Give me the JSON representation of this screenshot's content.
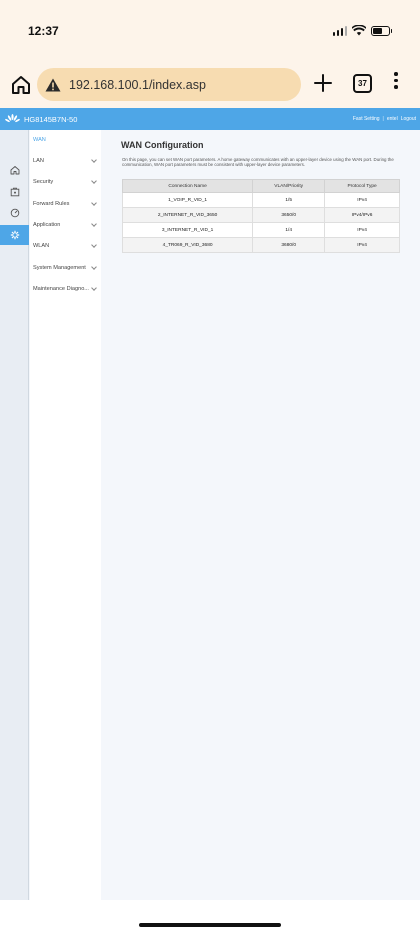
{
  "status_bar": {
    "time": "12:37"
  },
  "browser": {
    "url": "192.168.100.1/index.asp",
    "tab_count": "37"
  },
  "header": {
    "model": "HG8145B7N-50",
    "fast_setting": "Fast Setting",
    "separator": "|",
    "user": "entel",
    "logout": "Logout"
  },
  "sidebar": {
    "items": [
      {
        "label": "WAN"
      },
      {
        "label": "LAN"
      },
      {
        "label": "Security"
      },
      {
        "label": "Forward Rules"
      },
      {
        "label": "Application"
      },
      {
        "label": "WLAN"
      },
      {
        "label": "System Management"
      },
      {
        "label": "Maintenance Diagno..."
      }
    ]
  },
  "main": {
    "title": "WAN Configuration",
    "description": "On this page, you can set WAN port parameters. A home gateway communicates with an upper-layer device using the WAN port. During the communication, WAN port parameters must be consistent with upper-layer device parameters.",
    "table": {
      "columns": [
        "Connection Name",
        "VLAN/Priority",
        "Protocol Type"
      ],
      "rows": [
        [
          "1_VOIP_R_VID_1",
          "1/5",
          "IPv4"
        ],
        [
          "2_INTERNET_R_VID_3650",
          "3650/0",
          "IPv4/IPv6"
        ],
        [
          "3_INTERNET_R_VID_1",
          "1/4",
          "IPv4"
        ],
        [
          "4_TR069_R_VID_3680",
          "3680/0",
          "IPv4"
        ]
      ]
    }
  },
  "colors": {
    "accent": "#4ea6e7",
    "browser_bg": "#fdf4ea",
    "url_pill": "#f7dcb1"
  },
  "icons": [
    "home-icon",
    "warning-icon",
    "plus-icon",
    "tabs-icon",
    "more-icon",
    "huawei-logo-icon",
    "house-icon",
    "lock-box-icon",
    "gauge-icon",
    "gear-icon",
    "chevron-down-icon"
  ]
}
